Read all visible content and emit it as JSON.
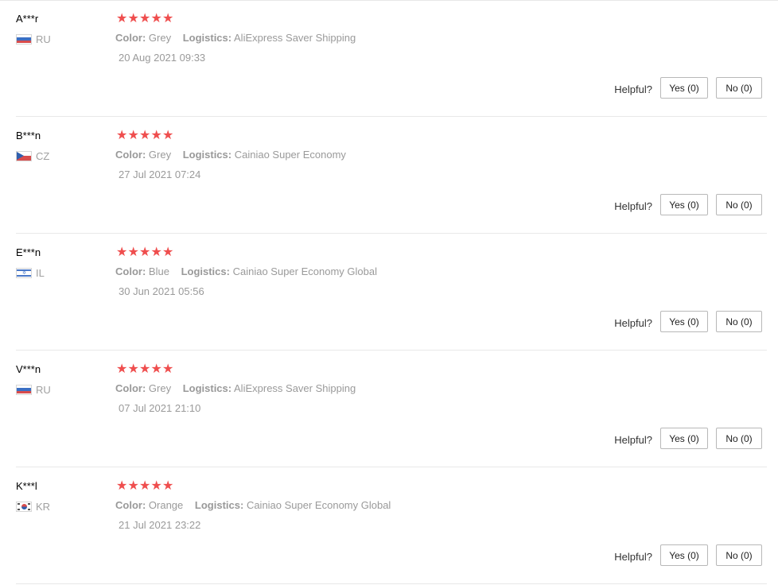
{
  "colors": {
    "star": "#ef4e4e",
    "muted_text": "#9a9a9a",
    "divider": "#e8e8e8",
    "button_border": "#b8b8b8"
  },
  "reviews": [
    {
      "user": "A***r",
      "country": "RU",
      "flag_icon": "russia-flag-icon",
      "rating": 5,
      "color_label": "Color:",
      "color_value": "Grey",
      "logistics_label": "Logistics:",
      "logistics_value": "AliExpress Saver Shipping",
      "date": "20 Aug 2021 09:33",
      "helpful_label": "Helpful?",
      "yes_label": "Yes (0)",
      "no_label": "No (0)"
    },
    {
      "user": "B***n",
      "country": "CZ",
      "flag_icon": "czech-flag-icon",
      "rating": 5,
      "color_label": "Color:",
      "color_value": "Grey",
      "logistics_label": "Logistics:",
      "logistics_value": "Cainiao Super Economy",
      "date": "27 Jul 2021 07:24",
      "helpful_label": "Helpful?",
      "yes_label": "Yes (0)",
      "no_label": "No (0)"
    },
    {
      "user": "E***n",
      "country": "IL",
      "flag_icon": "israel-flag-icon",
      "rating": 5,
      "color_label": "Color:",
      "color_value": "Blue",
      "logistics_label": "Logistics:",
      "logistics_value": "Cainiao Super Economy Global",
      "date": "30 Jun 2021 05:56",
      "helpful_label": "Helpful?",
      "yes_label": "Yes (0)",
      "no_label": "No (0)"
    },
    {
      "user": "V***n",
      "country": "RU",
      "flag_icon": "russia-flag-icon",
      "rating": 5,
      "color_label": "Color:",
      "color_value": "Grey",
      "logistics_label": "Logistics:",
      "logistics_value": "AliExpress Saver Shipping",
      "date": "07 Jul 2021 21:10",
      "helpful_label": "Helpful?",
      "yes_label": "Yes (0)",
      "no_label": "No (0)"
    },
    {
      "user": "K***l",
      "country": "KR",
      "flag_icon": "south-korea-flag-icon",
      "rating": 5,
      "color_label": "Color:",
      "color_value": "Orange",
      "logistics_label": "Logistics:",
      "logistics_value": "Cainiao Super Economy Global",
      "date": "21 Jul 2021 23:22",
      "helpful_label": "Helpful?",
      "yes_label": "Yes (0)",
      "no_label": "No (0)"
    }
  ]
}
